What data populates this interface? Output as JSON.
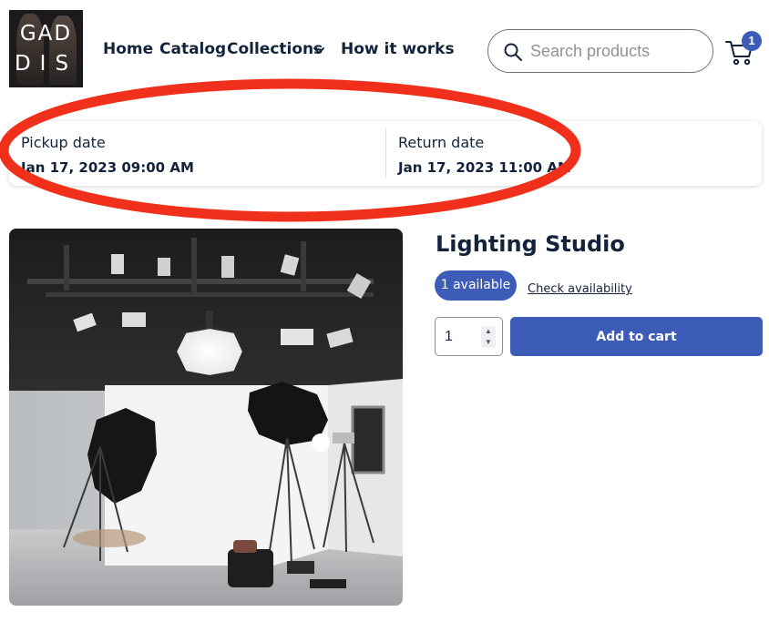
{
  "logo": {
    "line1": "GAD",
    "line2": "DIS"
  },
  "nav": {
    "items": [
      {
        "label": "Home"
      },
      {
        "label": "Catalog"
      },
      {
        "label": "Collections"
      },
      {
        "label": "How it works"
      }
    ]
  },
  "search": {
    "placeholder": "Search products",
    "value": ""
  },
  "cart": {
    "count": "1"
  },
  "dates": {
    "pickup_label": "Pickup date",
    "pickup_value": "Jan 17, 2023 09:00 AM",
    "return_label": "Return date",
    "return_value": "Jan 17, 2023 11:00 AM"
  },
  "product": {
    "title": "Lighting Studio",
    "availability": "1 available",
    "check_link": "Check availability",
    "quantity": "1",
    "add_button": "Add to cart"
  },
  "colors": {
    "primary": "#3d5cb8",
    "text": "#14233c",
    "annotation": "#f0301b"
  },
  "icons": [
    "search-icon",
    "cart-icon",
    "chevron-down-icon",
    "chevron-up-icon"
  ]
}
